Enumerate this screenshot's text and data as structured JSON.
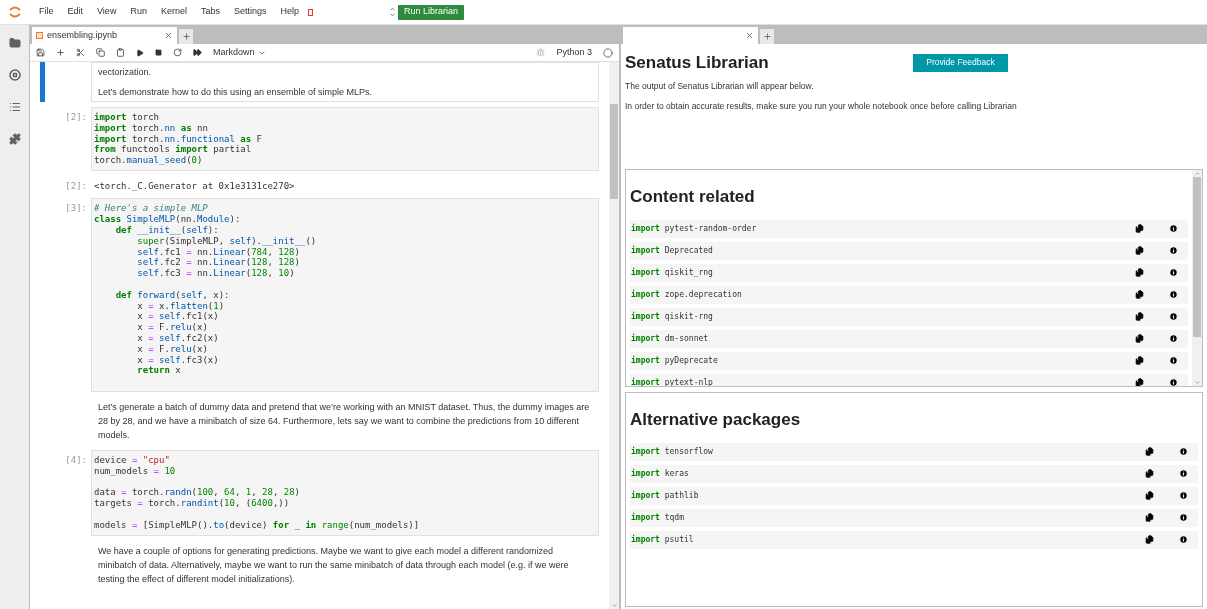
{
  "menu": [
    "File",
    "Edit",
    "View",
    "Run",
    "Kernel",
    "Tabs",
    "Settings",
    "Help"
  ],
  "run_button": "Run Librarian",
  "notebook": {
    "tab": {
      "title": "ensembling.ipynb",
      "selected": true
    },
    "cell_type": "Markdown",
    "kernel": "Python 3",
    "cells": [
      {
        "kind": "markdown",
        "selected": true,
        "paragraphs": [
          "vectorization.",
          "Let’s demonstrate how to do this using an ensemble of simple MLPs."
        ]
      },
      {
        "kind": "code",
        "selected": false,
        "prompt": "[2]:",
        "lines": [
          {
            "kind": "code",
            "tokens": [
              {
                "text": "import",
                "kind": "kw"
              },
              {
                "text": " torch",
                "kind": "pl"
              }
            ]
          },
          {
            "kind": "code",
            "tokens": [
              {
                "text": "import",
                "kind": "kw"
              },
              {
                "text": " torch.",
                "kind": "pl"
              },
              {
                "text": "nn",
                "kind": "nm"
              },
              {
                "text": " as",
                "kind": "kw"
              },
              {
                "text": " nn",
                "kind": "pl"
              }
            ]
          },
          {
            "kind": "code",
            "tokens": [
              {
                "text": "import",
                "kind": "kw"
              },
              {
                "text": " torch.",
                "kind": "pl"
              },
              {
                "text": "nn.functional",
                "kind": "nm"
              },
              {
                "text": " as",
                "kind": "kw"
              },
              {
                "text": " F",
                "kind": "pl"
              }
            ]
          },
          {
            "kind": "code",
            "tokens": [
              {
                "text": "from",
                "kind": "kw"
              },
              {
                "text": " functools ",
                "kind": "pl"
              },
              {
                "text": "import",
                "kind": "kw"
              },
              {
                "text": " partial",
                "kind": "pl"
              }
            ]
          },
          {
            "kind": "code",
            "tokens": [
              {
                "text": "torch.",
                "kind": "pl"
              },
              {
                "text": "manual_seed",
                "kind": "nm"
              },
              {
                "text": "(",
                "kind": "pl"
              },
              {
                "text": "0",
                "kind": "num"
              },
              {
                "text": ")",
                "kind": "pl"
              }
            ]
          }
        ]
      },
      {
        "kind": "output",
        "selected": false,
        "prompt": "[2]:",
        "text": "<torch._C.Generator at 0x1e3131ce270>"
      },
      {
        "kind": "code",
        "selected": false,
        "prompt": "[3]:",
        "lines": [
          {
            "kind": "code",
            "tokens": [
              {
                "text": "# Here's a simple MLP",
                "kind": "cm"
              }
            ]
          },
          {
            "kind": "code",
            "tokens": [
              {
                "text": "class",
                "kind": "kw"
              },
              {
                "text": " SimpleMLP",
                "kind": "nm"
              },
              {
                "text": "(nn.",
                "kind": "pl"
              },
              {
                "text": "Module",
                "kind": "nm"
              },
              {
                "text": "):",
                "kind": "pl"
              }
            ]
          },
          {
            "kind": "code",
            "tokens": [
              {
                "text": "    def",
                "kind": "kw"
              },
              {
                "text": " __init__",
                "kind": "nm"
              },
              {
                "text": "(",
                "kind": "pl"
              },
              {
                "text": "self",
                "kind": "nm"
              },
              {
                "text": "):",
                "kind": "pl"
              }
            ]
          },
          {
            "kind": "code",
            "tokens": [
              {
                "text": "        super",
                "kind": "bi"
              },
              {
                "text": "(SimpleMLP, ",
                "kind": "pl"
              },
              {
                "text": "self",
                "kind": "nm"
              },
              {
                "text": ").",
                "kind": "pl"
              },
              {
                "text": "__init__",
                "kind": "nm"
              },
              {
                "text": "()",
                "kind": "pl"
              }
            ]
          },
          {
            "kind": "code",
            "tokens": [
              {
                "text": "        self",
                "kind": "nm"
              },
              {
                "text": ".fc1 ",
                "kind": "pl"
              },
              {
                "text": "=",
                "kind": "op"
              },
              {
                "text": " nn.",
                "kind": "pl"
              },
              {
                "text": "Linear",
                "kind": "nm"
              },
              {
                "text": "(",
                "kind": "pl"
              },
              {
                "text": "784",
                "kind": "num"
              },
              {
                "text": ", ",
                "kind": "pl"
              },
              {
                "text": "128",
                "kind": "num"
              },
              {
                "text": ")",
                "kind": "pl"
              }
            ]
          },
          {
            "kind": "code",
            "tokens": [
              {
                "text": "        self",
                "kind": "nm"
              },
              {
                "text": ".fc2 ",
                "kind": "pl"
              },
              {
                "text": "=",
                "kind": "op"
              },
              {
                "text": " nn.",
                "kind": "pl"
              },
              {
                "text": "Linear",
                "kind": "nm"
              },
              {
                "text": "(",
                "kind": "pl"
              },
              {
                "text": "128",
                "kind": "num"
              },
              {
                "text": ", ",
                "kind": "pl"
              },
              {
                "text": "128",
                "kind": "num"
              },
              {
                "text": ")",
                "kind": "pl"
              }
            ]
          },
          {
            "kind": "code",
            "tokens": [
              {
                "text": "        self",
                "kind": "nm"
              },
              {
                "text": ".fc3 ",
                "kind": "pl"
              },
              {
                "text": "=",
                "kind": "op"
              },
              {
                "text": " nn.",
                "kind": "pl"
              },
              {
                "text": "Linear",
                "kind": "nm"
              },
              {
                "text": "(",
                "kind": "pl"
              },
              {
                "text": "128",
                "kind": "num"
              },
              {
                "text": ", ",
                "kind": "pl"
              },
              {
                "text": "10",
                "kind": "num"
              },
              {
                "text": ")",
                "kind": "pl"
              }
            ]
          },
          {
            "kind": "blank"
          },
          {
            "kind": "code",
            "tokens": [
              {
                "text": "    def",
                "kind": "kw"
              },
              {
                "text": " forward",
                "kind": "nm"
              },
              {
                "text": "(",
                "kind": "pl"
              },
              {
                "text": "self",
                "kind": "nm"
              },
              {
                "text": ", x):",
                "kind": "pl"
              }
            ]
          },
          {
            "kind": "code",
            "tokens": [
              {
                "text": "        x ",
                "kind": "pl"
              },
              {
                "text": "=",
                "kind": "op"
              },
              {
                "text": " x.",
                "kind": "pl"
              },
              {
                "text": "flatten",
                "kind": "nm"
              },
              {
                "text": "(",
                "kind": "pl"
              },
              {
                "text": "1",
                "kind": "num"
              },
              {
                "text": ")",
                "kind": "pl"
              }
            ]
          },
          {
            "kind": "code",
            "tokens": [
              {
                "text": "        x ",
                "kind": "pl"
              },
              {
                "text": "=",
                "kind": "op"
              },
              {
                "text": " self",
                "kind": "nm"
              },
              {
                "text": ".fc1(x)",
                "kind": "pl"
              }
            ]
          },
          {
            "kind": "code",
            "tokens": [
              {
                "text": "        x ",
                "kind": "pl"
              },
              {
                "text": "=",
                "kind": "op"
              },
              {
                "text": " F.",
                "kind": "pl"
              },
              {
                "text": "relu",
                "kind": "nm"
              },
              {
                "text": "(x)",
                "kind": "pl"
              }
            ]
          },
          {
            "kind": "code",
            "tokens": [
              {
                "text": "        x ",
                "kind": "pl"
              },
              {
                "text": "=",
                "kind": "op"
              },
              {
                "text": " self",
                "kind": "nm"
              },
              {
                "text": ".fc2(x)",
                "kind": "pl"
              }
            ]
          },
          {
            "kind": "code",
            "tokens": [
              {
                "text": "        x ",
                "kind": "pl"
              },
              {
                "text": "=",
                "kind": "op"
              },
              {
                "text": " F.",
                "kind": "pl"
              },
              {
                "text": "relu",
                "kind": "nm"
              },
              {
                "text": "(x)",
                "kind": "pl"
              }
            ]
          },
          {
            "kind": "code",
            "tokens": [
              {
                "text": "        x ",
                "kind": "pl"
              },
              {
                "text": "=",
                "kind": "op"
              },
              {
                "text": " self",
                "kind": "nm"
              },
              {
                "text": ".fc3(x)",
                "kind": "pl"
              }
            ]
          },
          {
            "kind": "code",
            "tokens": [
              {
                "text": "        return",
                "kind": "kw"
              },
              {
                "text": " x",
                "kind": "pl"
              }
            ]
          },
          {
            "kind": "blank"
          }
        ]
      },
      {
        "kind": "markdown",
        "selected": false,
        "paragraphs": [
          "Let’s generate a batch of dummy data and pretend that we’re working with an MNIST dataset. Thus, the dummy images are 28 by 28, and we have a minibatch of size 64. Furthermore, lets say we want to combine the predictions from 10 different models."
        ]
      },
      {
        "kind": "code",
        "selected": false,
        "prompt": "[4]:",
        "lines": [
          {
            "kind": "code",
            "tokens": [
              {
                "text": "device ",
                "kind": "pl"
              },
              {
                "text": "=",
                "kind": "op"
              },
              {
                "text": " \"cpu\"",
                "kind": "str"
              }
            ]
          },
          {
            "kind": "code",
            "tokens": [
              {
                "text": "num_models ",
                "kind": "pl"
              },
              {
                "text": "=",
                "kind": "op"
              },
              {
                "text": " 10",
                "kind": "num"
              }
            ]
          },
          {
            "kind": "blank"
          },
          {
            "kind": "code",
            "tokens": [
              {
                "text": "data ",
                "kind": "pl"
              },
              {
                "text": "=",
                "kind": "op"
              },
              {
                "text": " torch.",
                "kind": "pl"
              },
              {
                "text": "randn",
                "kind": "nm"
              },
              {
                "text": "(",
                "kind": "pl"
              },
              {
                "text": "100",
                "kind": "num"
              },
              {
                "text": ", ",
                "kind": "pl"
              },
              {
                "text": "64",
                "kind": "num"
              },
              {
                "text": ", ",
                "kind": "pl"
              },
              {
                "text": "1",
                "kind": "num"
              },
              {
                "text": ", ",
                "kind": "pl"
              },
              {
                "text": "28",
                "kind": "num"
              },
              {
                "text": ", ",
                "kind": "pl"
              },
              {
                "text": "28",
                "kind": "num"
              },
              {
                "text": ")",
                "kind": "pl"
              }
            ]
          },
          {
            "kind": "code",
            "tokens": [
              {
                "text": "targets ",
                "kind": "pl"
              },
              {
                "text": "=",
                "kind": "op"
              },
              {
                "text": " torch.",
                "kind": "pl"
              },
              {
                "text": "randint",
                "kind": "nm"
              },
              {
                "text": "(",
                "kind": "pl"
              },
              {
                "text": "10",
                "kind": "num"
              },
              {
                "text": ", (",
                "kind": "pl"
              },
              {
                "text": "6400",
                "kind": "num"
              },
              {
                "text": ",))",
                "kind": "pl"
              }
            ]
          },
          {
            "kind": "blank"
          },
          {
            "kind": "code",
            "tokens": [
              {
                "text": "models ",
                "kind": "pl"
              },
              {
                "text": "=",
                "kind": "op"
              },
              {
                "text": " [SimpleMLP().",
                "kind": "pl"
              },
              {
                "text": "to",
                "kind": "nm"
              },
              {
                "text": "(device) ",
                "kind": "pl"
              },
              {
                "text": "for",
                "kind": "kw"
              },
              {
                "text": " _ ",
                "kind": "pl"
              },
              {
                "text": "in",
                "kind": "kw"
              },
              {
                "text": " range",
                "kind": "bi"
              },
              {
                "text": "(num_models)]",
                "kind": "pl"
              }
            ]
          }
        ]
      },
      {
        "kind": "markdown",
        "selected": false,
        "paragraphs": [
          "We have a couple of options for generating predictions. Maybe we want to give each model a different randomized minibatch of data. Alternatively, maybe we want to run the same minibatch of data through each model (e.g. if we were testing the effect of different model initializations)."
        ]
      }
    ]
  },
  "librarian": {
    "title": "Senatus Librarian",
    "feedback_button": "Provide Feedback",
    "notes": [
      "The output of Senatus Librarian will appear below.",
      "In order to obtain accurate results, make sure you run your whole notebook once before calling Librarian"
    ],
    "sections": [
      {
        "title": "Content related",
        "packages": [
          {
            "keyword": "import",
            "name": "pytest-random-order"
          },
          {
            "keyword": "import",
            "name": "Deprecated"
          },
          {
            "keyword": "import",
            "name": "qiskit_rng"
          },
          {
            "keyword": "import",
            "name": "zope.deprecation"
          },
          {
            "keyword": "import",
            "name": "qiskit-rng"
          },
          {
            "keyword": "import",
            "name": "dm-sonnet"
          },
          {
            "keyword": "import",
            "name": "pyDeprecate"
          },
          {
            "keyword": "import",
            "name": "pytext-nlp"
          }
        ]
      },
      {
        "title": "Alternative packages",
        "packages": [
          {
            "keyword": "import",
            "name": "tensorflow"
          },
          {
            "keyword": "import",
            "name": "keras"
          },
          {
            "keyword": "import",
            "name": "pathlib"
          },
          {
            "keyword": "import",
            "name": "tqdm"
          },
          {
            "keyword": "import",
            "name": "psutil"
          }
        ]
      }
    ]
  }
}
